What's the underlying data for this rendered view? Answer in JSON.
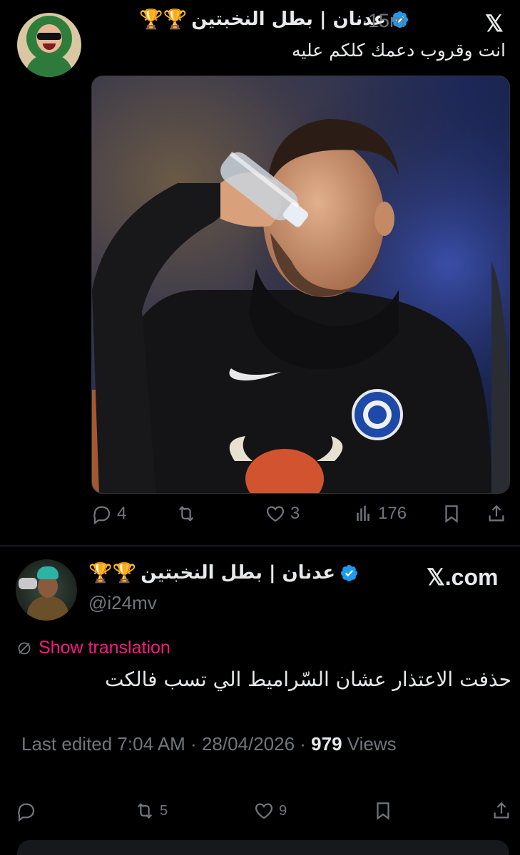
{
  "tweet1": {
    "author_name": "عدنان | بطل النخبتين",
    "trophies": "🏆🏆",
    "time": "·15m",
    "platform_logo": "𝕏",
    "text": "انت وقروب دعمك كلكم عليه",
    "actions": {
      "reply_count": "4",
      "repost_count": "",
      "like_count": "3",
      "views_count": "176"
    }
  },
  "tweet2": {
    "author_name": "عدنان | بطل النخبتين",
    "trophies": "🏆🏆",
    "handle": "@i24mv",
    "watermark": "𝕏.com",
    "translate_label": "Show translation",
    "text": "حذفت الاعتذار عشان السّراميط الي تسب فالكت",
    "meta": {
      "edited_label": "Last edited 7:04 AM · 28/04/2026 · ",
      "views_count": "979",
      "views_label": " Views"
    },
    "actions": {
      "repost_count": "5",
      "like_count": "9"
    }
  },
  "colors": {
    "background": "#000000",
    "text_primary": "#e7e9ea",
    "text_secondary": "#71767b",
    "verified_blue": "#1d9bf0",
    "translate_pink": "#f91880"
  }
}
